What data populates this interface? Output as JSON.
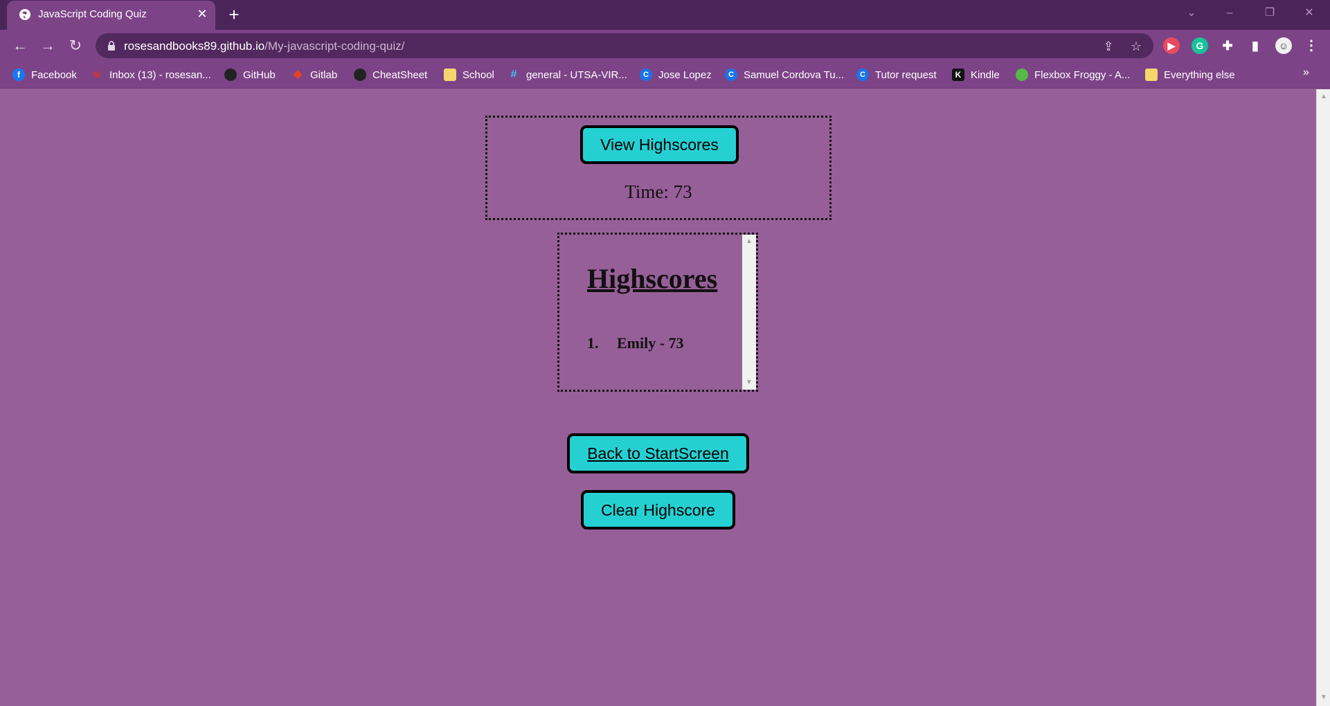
{
  "browser": {
    "tab_title": "JavaScript Coding Quiz",
    "tab_close": "✕",
    "new_tab": "+",
    "url_host": "rosesandbooks89.github.io",
    "url_path": "/My-javascript-coding-quiz/",
    "bookmarks": [
      {
        "label": "Facebook",
        "icon": "facebook-icon",
        "color": "#1877f2",
        "glyph": "f"
      },
      {
        "label": "Inbox (13) - rosesan...",
        "icon": "gmail-icon",
        "color": "#d93025",
        "glyph": "M"
      },
      {
        "label": "GitHub",
        "icon": "github-icon",
        "color": "#222222",
        "glyph": "●"
      },
      {
        "label": "Gitlab",
        "icon": "gitlab-icon",
        "color": "#e24329",
        "glyph": "◆"
      },
      {
        "label": "CheatSheet",
        "icon": "github-icon",
        "color": "#222222",
        "glyph": "●"
      },
      {
        "label": "School",
        "icon": "folder-icon",
        "color": "#f6d56d",
        "glyph": ""
      },
      {
        "label": "general - UTSA-VIR...",
        "icon": "slack-icon",
        "color": "#36c5f0",
        "glyph": "#"
      },
      {
        "label": "Jose Lopez",
        "icon": "c-icon",
        "color": "#1a73e8",
        "glyph": "C"
      },
      {
        "label": "Samuel Cordova Tu...",
        "icon": "c-icon",
        "color": "#1a73e8",
        "glyph": "C"
      },
      {
        "label": "Tutor request",
        "icon": "c-icon",
        "color": "#1a73e8",
        "glyph": "C"
      },
      {
        "label": "Kindle",
        "icon": "kindle-icon",
        "color": "#111111",
        "glyph": "K"
      },
      {
        "label": "Flexbox Froggy - A...",
        "icon": "frog-icon",
        "color": "#56b84a",
        "glyph": "☻"
      },
      {
        "label": "Everything else",
        "icon": "folder-icon",
        "color": "#f6d56d",
        "glyph": ""
      }
    ],
    "bookmarks_more": "»"
  },
  "header": {
    "view_highscores": "View Highscores",
    "time_text": "Time: 73"
  },
  "highscores": {
    "title": "Highscores",
    "items": [
      {
        "rank": "1.",
        "entry": "Emily - 73"
      }
    ]
  },
  "actions": {
    "back_label": "Back to StartScreen",
    "clear_label": "Clear Highscore"
  },
  "colors": {
    "page_bg": "#975f98",
    "button_bg": "#25d0d2",
    "chrome_bg": "#7d4387"
  }
}
